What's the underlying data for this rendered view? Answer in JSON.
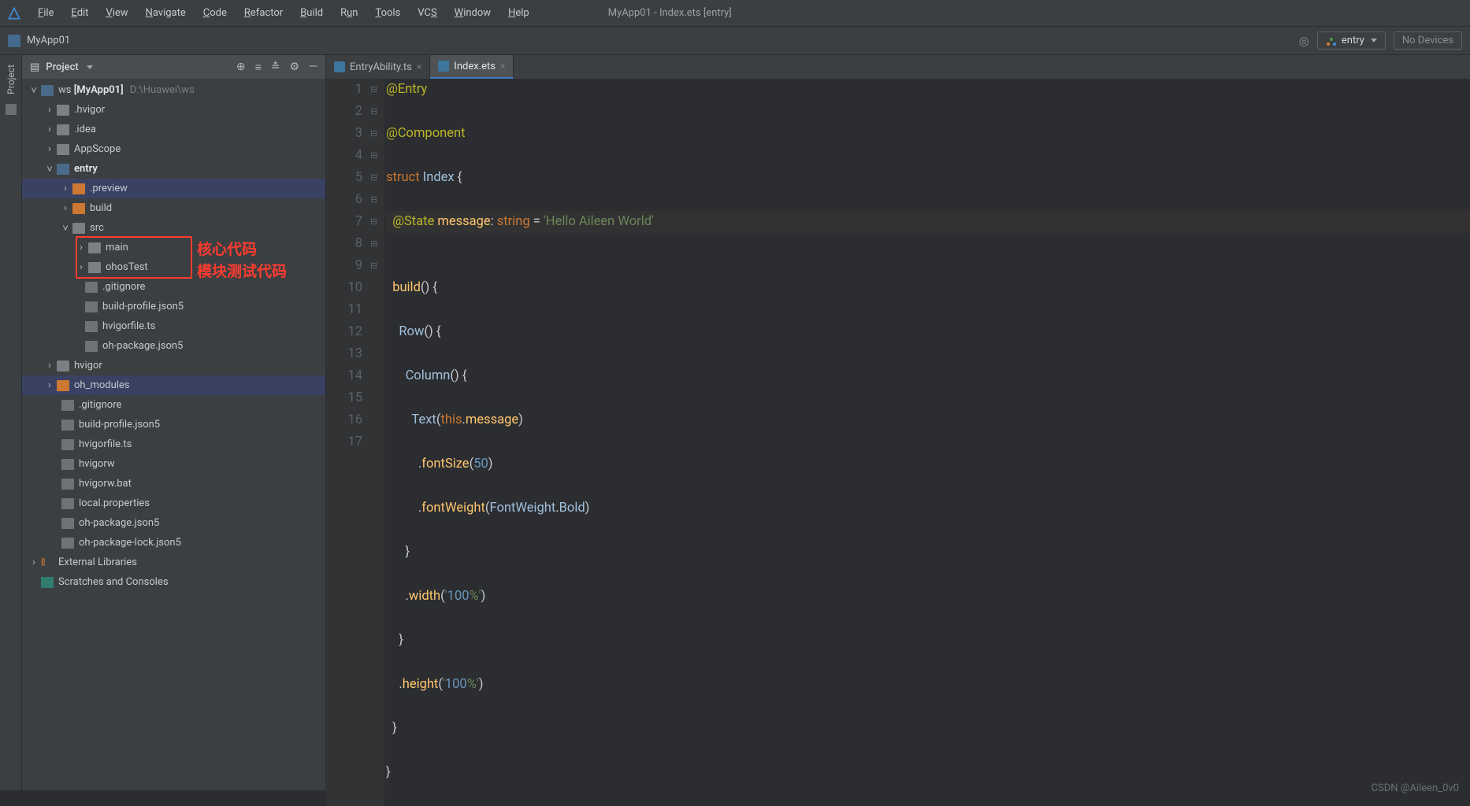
{
  "window": {
    "title": "MyApp01 - Index.ets [entry]",
    "crumb": "MyApp01"
  },
  "menu": [
    "File",
    "Edit",
    "View",
    "Navigate",
    "Code",
    "Refactor",
    "Build",
    "Run",
    "Tools",
    "VCS",
    "Window",
    "Help"
  ],
  "toolbar": {
    "run_config": "entry",
    "no_device": "No Devices"
  },
  "sidebar": {
    "tab": "Project"
  },
  "project_panel": {
    "title": "Project"
  },
  "tree": {
    "root": {
      "name": "ws",
      "project": "[MyApp01]",
      "path": "D:\\Huawei\\ws"
    },
    "l1": [
      ".hvigor",
      ".idea",
      "AppScope",
      "entry"
    ],
    "entry_children": [
      ".preview",
      "build",
      "src"
    ],
    "src_children": [
      "main",
      "ohosTest"
    ],
    "entry_files": [
      ".gitignore",
      "build-profile.json5",
      "hvigorfile.ts",
      "oh-package.json5"
    ],
    "root_more": [
      "hvigor",
      "oh_modules"
    ],
    "root_files": [
      ".gitignore",
      "build-profile.json5",
      "hvigorfile.ts",
      "hvigorw",
      "hvigorw.bat",
      "local.properties",
      "oh-package.json5",
      "oh-package-lock.json5"
    ],
    "ext_lib": "External Libraries",
    "scratches": "Scratches and Consoles"
  },
  "annotations": {
    "main": "核心代码",
    "ohosTest": "模块测试代码"
  },
  "tabs": [
    {
      "name": "EntryAbility.ts",
      "active": false
    },
    {
      "name": "Index.ets",
      "active": true
    }
  ],
  "code": {
    "lines": [
      "@Entry",
      "@Component",
      "struct Index {",
      "  @State message: string = 'Hello Aileen World'",
      "",
      "  build() {",
      "    Row() {",
      "      Column() {",
      "        Text(this.message)",
      "          .fontSize(50)",
      "          .fontWeight(FontWeight.Bold)",
      "      }",
      "      .width('100%')",
      "    }",
      "    .height('100%')",
      "  }",
      "}"
    ],
    "current_line": 4
  },
  "watermark": "CSDN @Aileen_0v0"
}
